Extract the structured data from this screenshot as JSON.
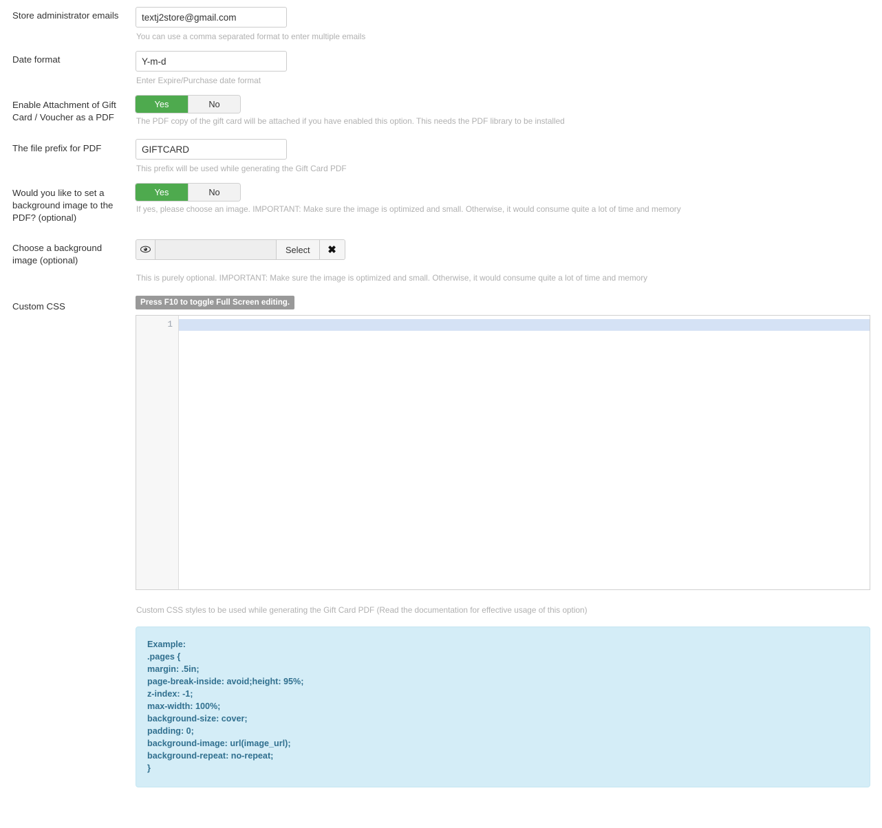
{
  "rows": {
    "admin_emails": {
      "label": "Store administrator emails",
      "value": "textj2store@gmail.com",
      "placeholder": "",
      "help": "You can use a comma separated format to enter multiple emails"
    },
    "date_format": {
      "label": "Date format",
      "value": "Y-m-d",
      "placeholder": "",
      "help": "Enter Expire/Purchase date format"
    },
    "enable_pdf_attachment": {
      "label": "Enable Attachment of Gift Card / Voucher as a PDF",
      "yes_label": "Yes",
      "no_label": "No",
      "selected": "Yes",
      "help": "The PDF copy of the gift card will be attached if you have enabled this option. This needs the PDF library to be installed"
    },
    "file_prefix": {
      "label": "The file prefix for PDF",
      "value": "GIFTCARD",
      "placeholder": "",
      "help": "This prefix will be used while generating the Gift Card PDF"
    },
    "set_background_image": {
      "label": "Would you like to set a background image to the PDF? (optional)",
      "yes_label": "Yes",
      "no_label": "No",
      "selected": "Yes",
      "help": "If yes, please choose an image. IMPORTANT: Make sure the image is optimized and small. Otherwise, it would consume quite a lot of time and memory"
    },
    "choose_background_image": {
      "label": "Choose a background image (optional)",
      "field_value": "",
      "field_placeholder": "",
      "preview_icon": "eye-icon",
      "select_label": "Select",
      "clear_icon": "close-icon",
      "clear_label": "✖",
      "help": "This is purely optional. IMPORTANT: Make sure the image is optimized and small. Otherwise, it would consume quite a lot of time and memory"
    },
    "custom_css": {
      "label": "Custom CSS",
      "fullscreen_hint": "Press F10 to toggle Full Screen editing.",
      "line_numbers": [
        "1"
      ],
      "code_value": "",
      "help": "Custom CSS styles to be used while generating the Gift Card PDF (Read the documentation for effective usage of this option)"
    }
  },
  "example_panel": {
    "lines": [
      "Example:",
      ".pages {",
      "margin: .5in;",
      "page-break-inside: avoid;height: 95%;",
      "z-index: -1;",
      "max-width: 100%;",
      "background-size: cover;",
      "padding: 0;",
      "background-image: url(image_url);",
      "background-repeat: no-repeat;",
      "}"
    ]
  },
  "colors": {
    "toggle_on": "#4eaa4e",
    "toggle_off": "#f2f2f2",
    "info_background": "#d4edf7",
    "info_text": "#31708f",
    "active_line": "#d5e2f5",
    "help_text": "#b0b0b0",
    "hint_badge": "#999999"
  }
}
